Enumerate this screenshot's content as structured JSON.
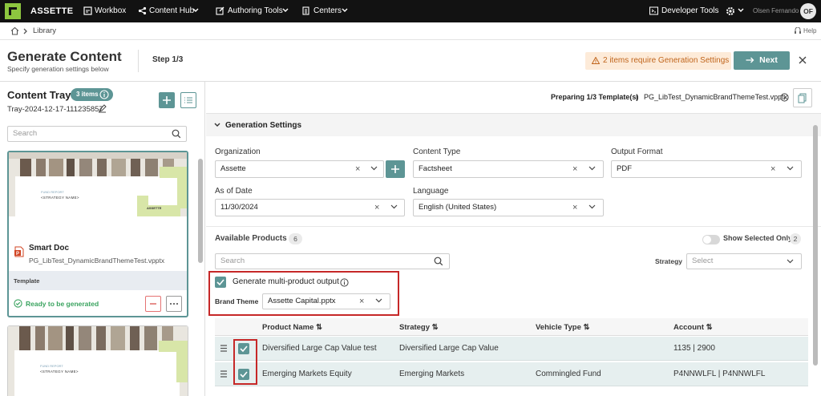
{
  "nav": {
    "brand": "ASSETTE",
    "items": [
      "Workbox",
      "Content Hub",
      "Authoring Tools",
      "Centers"
    ],
    "developer_tools": "Developer Tools",
    "user_name": "Olsen Fernando",
    "avatar_initials": "OF"
  },
  "breadcrumb": {
    "library": "Library",
    "help": "Help"
  },
  "header": {
    "title": "Generate Content",
    "subtitle": "Specify generation settings below",
    "step": "Step 1/3",
    "warning": "2 items require Generation Settings",
    "next": "Next"
  },
  "tray": {
    "title": "Content Tray",
    "items_badge": "3 items",
    "tray_name": "Tray-2024-12-17-111235857",
    "search_placeholder": "Search",
    "card": {
      "thumb_line1": "FUND REPORT",
      "thumb_line2": "<STRATEGY NAME>",
      "thumb_logo": "ASSETTE",
      "name": "Smart Doc",
      "file": "PG_LibTest_DynamicBrandThemeTest.vpptx",
      "type": "Template",
      "status": "Ready to be generated"
    }
  },
  "panel": {
    "preparing_label": "Preparing 1/3 Template(s)",
    "preparing_file": "PG_LibTest_DynamicBrandThemeTest.vpptx",
    "section_title": "Generation Settings",
    "fields": {
      "organization": {
        "label": "Organization",
        "value": "Assette"
      },
      "content_type": {
        "label": "Content Type",
        "value": "Factsheet"
      },
      "output_format": {
        "label": "Output Format",
        "value": "PDF"
      },
      "as_of_date": {
        "label": "As of Date",
        "value": "11/30/2024"
      },
      "language": {
        "label": "Language",
        "value": "English (United States)"
      }
    },
    "available_products": "Available Products",
    "products_count": "6",
    "show_selected": "Show Selected Only",
    "selected_count": "2",
    "search_placeholder": "Search",
    "strategy_label": "Strategy",
    "strategy_placeholder": "Select",
    "multi_product": "Generate multi-product output",
    "brand_theme_label": "Brand Theme",
    "brand_theme_value": "Assette Capital.pptx",
    "table": {
      "headers": [
        "Product Name",
        "Strategy",
        "Vehicle Type",
        "Account"
      ],
      "rows": [
        [
          "Diversified Large Cap Value test",
          "Diversified Large Cap Value",
          "",
          "1135 | 2900"
        ],
        [
          "Emerging Markets Equity",
          "Emerging Markets",
          "Commingled Fund",
          "P4NNWLFL | P4NNWLFL"
        ]
      ]
    }
  },
  "colors": {
    "accent": "#5d9595",
    "warning_bg": "#fdebd9",
    "warning_text": "#c0651c",
    "highlight": "#c62828",
    "nav_bg": "#121212",
    "logo": "#8dc63f"
  }
}
